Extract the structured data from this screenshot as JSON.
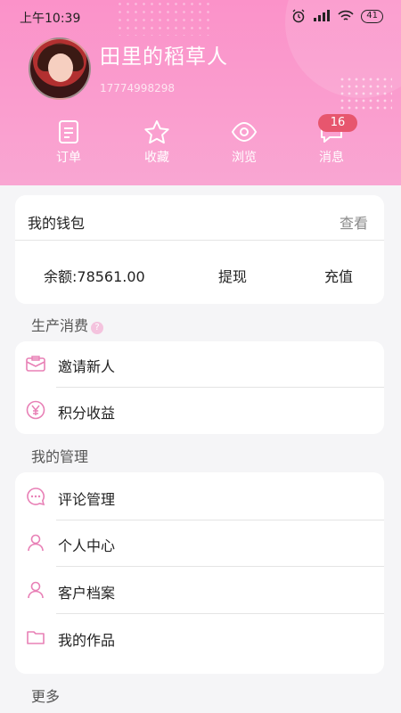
{
  "status_bar": {
    "time": "上午10:39",
    "battery": "41"
  },
  "profile": {
    "name": "田里的稻草人",
    "phone": "17774998298"
  },
  "quick_actions": [
    {
      "label": "订单",
      "icon": "order-icon"
    },
    {
      "label": "收藏",
      "icon": "star-icon"
    },
    {
      "label": "浏览",
      "icon": "eye-icon"
    },
    {
      "label": "消息",
      "icon": "message-icon",
      "badge": "16"
    }
  ],
  "wallet": {
    "title": "我的钱包",
    "view_label": "查看",
    "balance": "余额:78561.00",
    "withdraw_label": "提现",
    "recharge_label": "充值"
  },
  "sections": [
    {
      "title": "生产消费",
      "items": [
        {
          "label": "邀请新人",
          "icon": "invite-icon"
        },
        {
          "label": "积分收益",
          "icon": "yen-icon"
        }
      ]
    },
    {
      "title": "我的管理",
      "items": [
        {
          "label": "评论管理",
          "icon": "comment-icon"
        },
        {
          "label": "个人中心",
          "icon": "user-icon"
        },
        {
          "label": "客户档案",
          "icon": "user-icon"
        },
        {
          "label": "我的作品",
          "icon": "folder-icon"
        }
      ]
    },
    {
      "title": "更多",
      "items": []
    }
  ],
  "colors": {
    "header_pink": "#fb92c9",
    "icon_pink": "#e880b6",
    "badge_red": "#e7566e"
  }
}
